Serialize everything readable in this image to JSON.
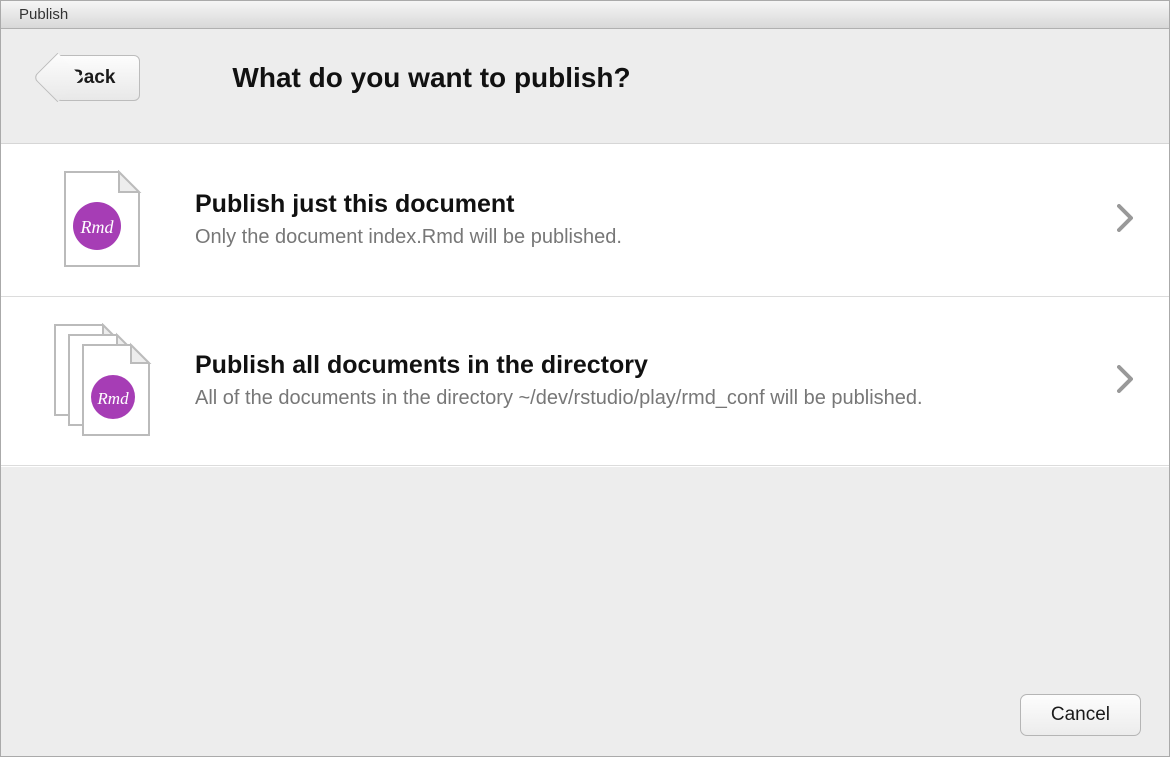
{
  "window": {
    "title": "Publish"
  },
  "header": {
    "back_label": "Back",
    "heading": "What do you want to publish?"
  },
  "options": [
    {
      "icon": "rmd-file-icon",
      "title": "Publish just this document",
      "description": "Only the document index.Rmd will be published."
    },
    {
      "icon": "rmd-file-stack-icon",
      "title": "Publish all documents in the directory",
      "description": "All of the documents in the directory ~/dev/rstudio/play/rmd_conf will be published."
    }
  ],
  "footer": {
    "cancel_label": "Cancel"
  },
  "icons": {
    "rmd_label": "Rmd"
  }
}
